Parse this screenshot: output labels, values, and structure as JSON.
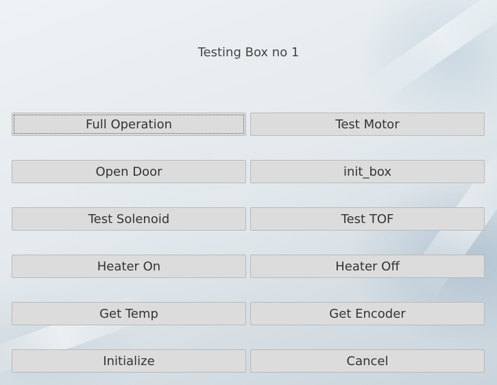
{
  "window": {
    "title": "Testing Box no 1"
  },
  "buttons": {
    "full_operation": "Full Operation",
    "test_motor": "Test Motor",
    "open_door": "Open Door",
    "init_box": "init_box",
    "test_solenoid": "Test Solenoid",
    "test_tof": "Test TOF",
    "heater_on": "Heater On",
    "heater_off": "Heater Off",
    "get_temp": "Get Temp",
    "get_encoder": "Get Encoder",
    "initialize": "Initialize",
    "cancel": "Cancel"
  },
  "focused_button": "full_operation",
  "colors": {
    "button_bg": "#dcdcdc",
    "button_border": "#b9b9b9",
    "text": "#333333"
  }
}
